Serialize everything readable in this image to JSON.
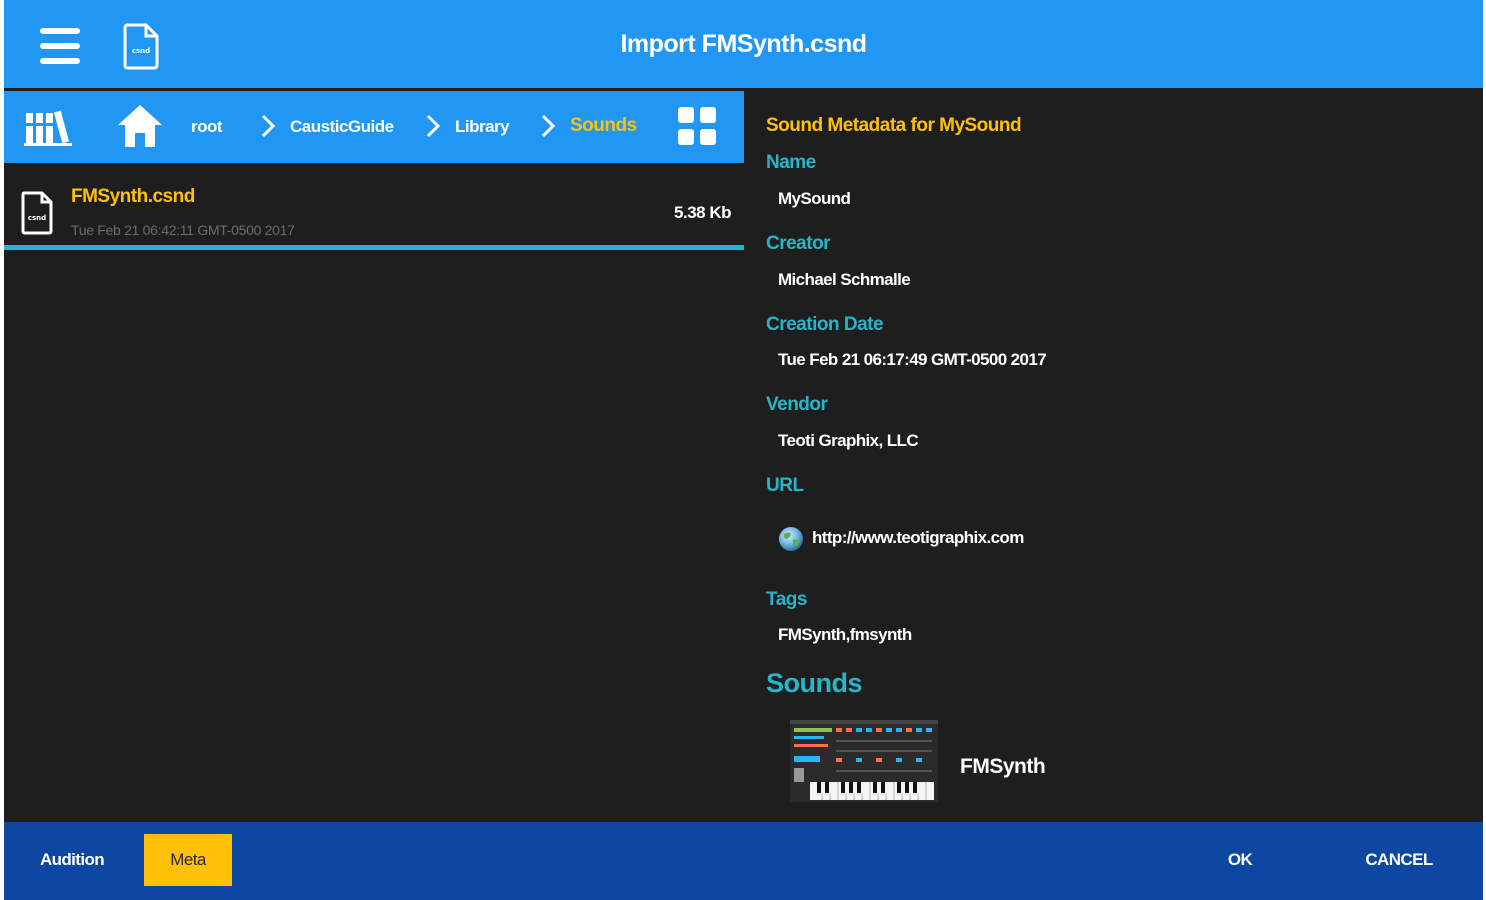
{
  "window": {
    "title": "Import FMSynth.csnd"
  },
  "breadcrumb": {
    "items": [
      "root",
      "CausticGuide",
      "Library"
    ],
    "current": "Sounds"
  },
  "file_list": [
    {
      "name": "FMSynth.csnd",
      "date": "Tue Feb 21 06:42:11 GMT-0500 2017",
      "size": "5.38 Kb",
      "icon_text": "csnd"
    }
  ],
  "metadata": {
    "heading": "Sound Metadata for MySound",
    "name_label": "Name",
    "name": "MySound",
    "creator_label": "Creator",
    "creator": "Michael Schmalle",
    "creation_date_label": "Creation Date",
    "creation_date": "Tue Feb 21 06:17:49 GMT-0500 2017",
    "vendor_label": "Vendor",
    "vendor": "Teoti Graphix, LLC",
    "url_label": "URL",
    "url": "http://www.teotigraphix.com",
    "tags_label": "Tags",
    "tags": "FMSynth,fmsynth",
    "sounds_heading": "Sounds",
    "sounds": [
      {
        "name": "FMSynth"
      }
    ]
  },
  "bottom_bar": {
    "audition": "Audition",
    "meta": "Meta",
    "ok": "OK",
    "cancel": "CANCEL"
  },
  "colors": {
    "primary_blue": "#2196f3",
    "dark_blue": "#0d47a1",
    "accent_yellow": "#ffc107",
    "teal": "#26b6c9",
    "background": "#1e1e1e"
  },
  "icons": [
    "menu-icon",
    "file-icon",
    "library-icon",
    "home-icon",
    "chevron-right-icon",
    "grid-view-icon",
    "globe-icon"
  ]
}
